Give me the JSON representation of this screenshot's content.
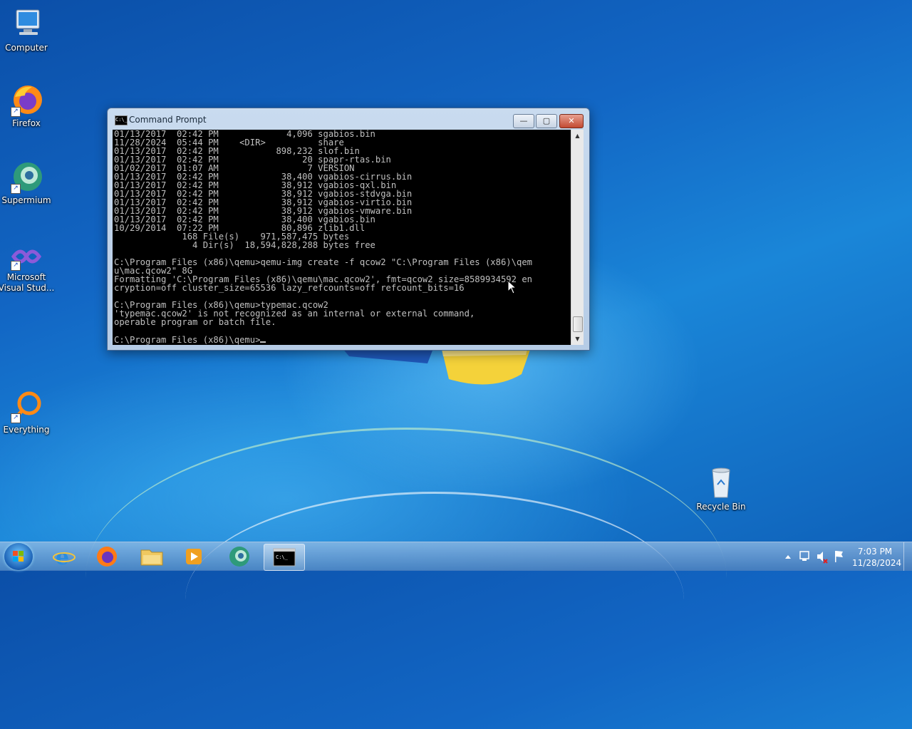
{
  "desktop": {
    "icons": [
      {
        "label": "Computer"
      },
      {
        "label": "Firefox"
      },
      {
        "label": "Supermium"
      },
      {
        "label": "Microsoft Visual Stud..."
      },
      {
        "label": "Everything"
      },
      {
        "label": "Recycle Bin"
      }
    ]
  },
  "window": {
    "title": "Command Prompt",
    "console_lines": [
      "01/13/2017  02:42 PM             4,096 sgabios.bin",
      "11/28/2024  05:44 PM    <DIR>          share",
      "01/13/2017  02:42 PM           898,232 slof.bin",
      "01/13/2017  02:42 PM                20 spapr-rtas.bin",
      "01/02/2017  01:07 AM                 7 VERSION",
      "01/13/2017  02:42 PM            38,400 vgabios-cirrus.bin",
      "01/13/2017  02:42 PM            38,912 vgabios-qxl.bin",
      "01/13/2017  02:42 PM            38,912 vgabios-stdvga.bin",
      "01/13/2017  02:42 PM            38,912 vgabios-virtio.bin",
      "01/13/2017  02:42 PM            38,912 vgabios-vmware.bin",
      "01/13/2017  02:42 PM            38,400 vgabios.bin",
      "10/29/2014  07:22 PM            80,896 zlib1.dll",
      "             168 File(s)    971,587,475 bytes",
      "               4 Dir(s)  18,594,828,288 bytes free",
      "",
      "C:\\Program Files (x86)\\qemu>qemu-img create -f qcow2 \"C:\\Program Files (x86)\\qem",
      "u\\mac.qcow2\" 8G",
      "Formatting 'C:\\Program Files (x86)\\qemu\\mac.qcow2', fmt=qcow2 size=8589934592 en",
      "cryption=off cluster_size=65536 lazy_refcounts=off refcount_bits=16",
      "",
      "C:\\Program Files (x86)\\qemu>typemac.qcow2",
      "'typemac.qcow2' is not recognized as an internal or external command,",
      "operable program or batch file.",
      ""
    ],
    "prompt": "C:\\Program Files (x86)\\qemu>",
    "buttons": {
      "minimize": "—",
      "maximize": "▢",
      "close": "✕"
    }
  },
  "taskbar": {
    "apps": [
      "internet-explorer",
      "firefox",
      "file-explorer",
      "media-player",
      "supermium",
      "command-prompt"
    ],
    "active_app": "command-prompt",
    "clock": {
      "time": "7:03 PM",
      "date": "11/28/2024"
    }
  },
  "colors": {
    "console_bg": "#000000",
    "console_fg": "#c0c0c0",
    "close_button": "#c24a32"
  }
}
